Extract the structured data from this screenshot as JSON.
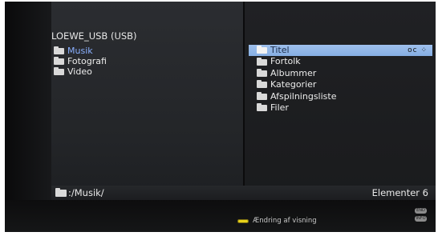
{
  "device_title": "LOEWE_USB (USB)",
  "left_list": [
    {
      "label": "Musik",
      "active": true
    },
    {
      "label": "Fotografi",
      "active": false
    },
    {
      "label": "Video",
      "active": false
    }
  ],
  "right_list": [
    {
      "label": "Titel",
      "selected": true
    },
    {
      "label": "Fortolk",
      "selected": false
    },
    {
      "label": "Albummer",
      "selected": false
    },
    {
      "label": "Kategorier",
      "selected": false
    },
    {
      "label": "Afspilningsliste",
      "selected": false
    },
    {
      "label": "Filer",
      "selected": false
    }
  ],
  "selected_icons": "oc ⁘",
  "path": ":/Musik/",
  "item_count": "Elementer 6",
  "hint": {
    "label": "Ændring af visning",
    "button_color": "#e8d21a"
  },
  "keys": {
    "end": "END",
    "info": "INFO"
  },
  "colors": {
    "selection": "#9ec0ec",
    "active_text": "#8ab0ff",
    "background": "#111214"
  }
}
